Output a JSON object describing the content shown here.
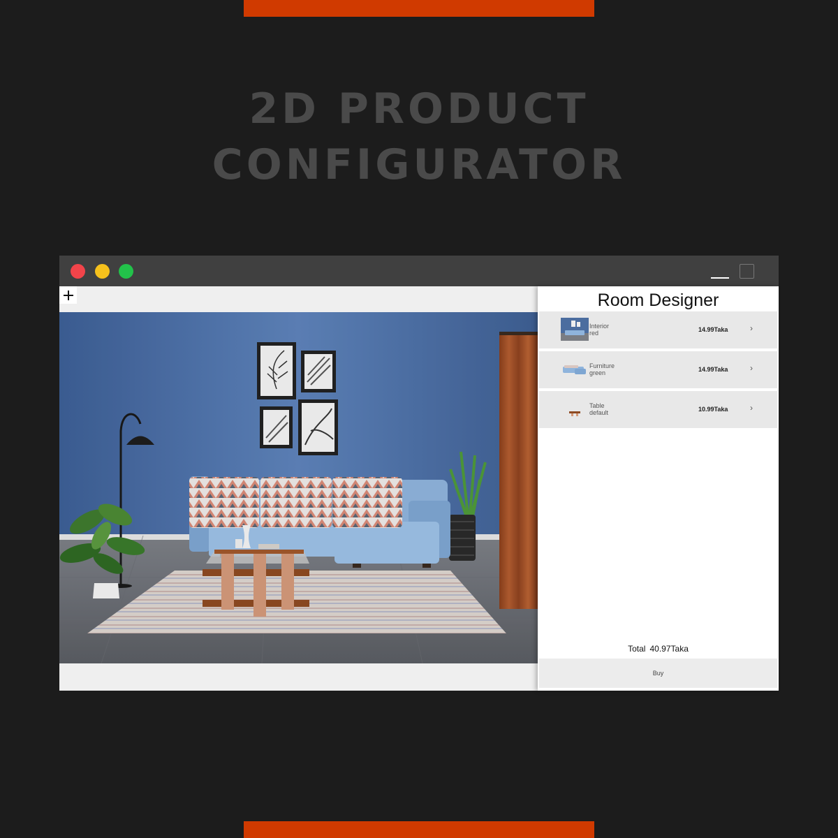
{
  "hero": {
    "line1": "2D PRODUCT",
    "line2": "CONFIGURATOR"
  },
  "window": {
    "controls": [
      "close",
      "minimize",
      "zoom"
    ],
    "buttons": [
      "minimize-icon",
      "maximize-icon"
    ]
  },
  "canvas": {
    "add_icon": "plus-icon",
    "add_label": "+"
  },
  "panel": {
    "title": "Room Designer",
    "items": [
      {
        "name": "Interior",
        "variant": "red",
        "price": "14.99Taka",
        "chevron": "›",
        "thumb": "wall-thumb"
      },
      {
        "name": "Furniture",
        "variant": "green",
        "price": "14.99Taka",
        "chevron": "›",
        "thumb": "sofa-thumb"
      },
      {
        "name": "Table",
        "variant": "default",
        "price": "10.99Taka",
        "chevron": "›",
        "thumb": "table-thumb"
      }
    ],
    "total_label": "Total",
    "total_value": "40.97Taka",
    "buy_label": "Buy"
  },
  "colors": {
    "background": "#1c1c1c",
    "accent": "#d03a00",
    "wall": "#4a6a9e",
    "sofa": "#8fb4dc",
    "curtain": "#a8552b"
  }
}
